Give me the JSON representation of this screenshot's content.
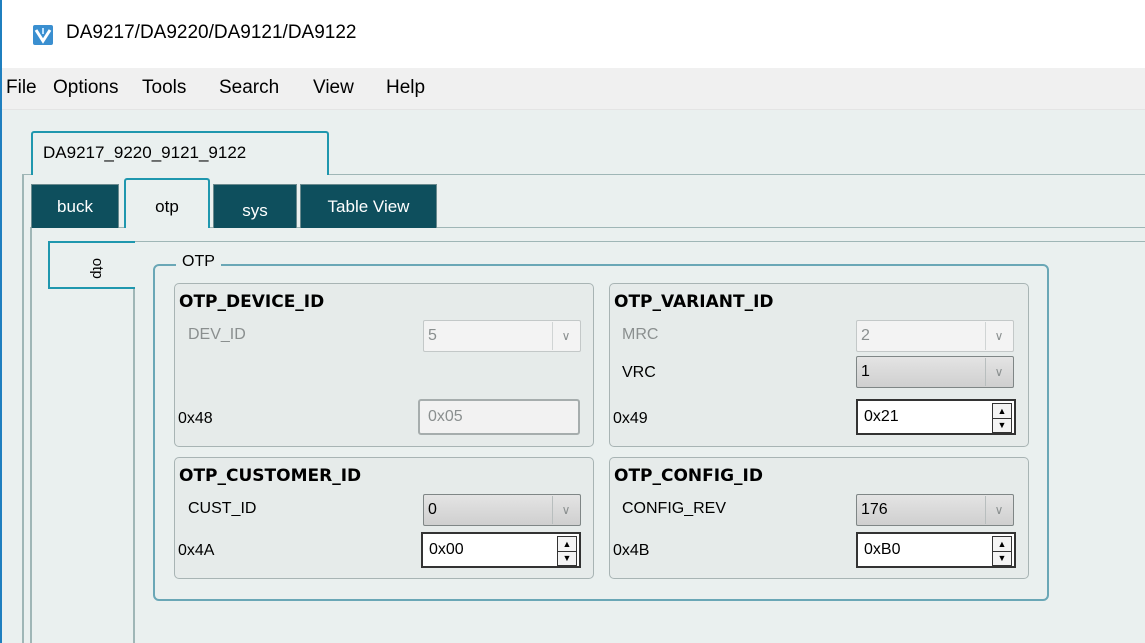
{
  "window": {
    "title": "DA9217/DA9220/DA9121/DA9122",
    "icon": "app-logo-icon"
  },
  "menu": [
    "File",
    "Options",
    "Tools",
    "Search",
    "View",
    "Help"
  ],
  "device_tab": "DA9217_9220_9121_9122",
  "tabs": [
    "buck",
    "otp",
    "sys",
    "Table View"
  ],
  "active_tab": "otp",
  "side_tab": "otp",
  "group": {
    "title": "OTP",
    "device_id": {
      "title": "OTP_DEVICE_ID",
      "field_label": "DEV_ID",
      "field_value": "5",
      "address": "0x48",
      "hex_value": "0x05"
    },
    "variant_id": {
      "title": "OTP_VARIANT_ID",
      "mrc_label": "MRC",
      "mrc_value": "2",
      "vrc_label": "VRC",
      "vrc_value": "1",
      "address": "0x49",
      "hex_value": "0x21"
    },
    "customer_id": {
      "title": "OTP_CUSTOMER_ID",
      "field_label": "CUST_ID",
      "field_value": "0",
      "address": "0x4A",
      "hex_value": "0x00"
    },
    "config_id": {
      "title": "OTP_CONFIG_ID",
      "field_label": "CONFIG_REV",
      "field_value": "176",
      "address": "0x4B",
      "hex_value": "0xB0"
    }
  },
  "colors": {
    "accent": "#1f97ae",
    "tab_dark": "#0e4f5d",
    "background": "#eaf0ef"
  }
}
